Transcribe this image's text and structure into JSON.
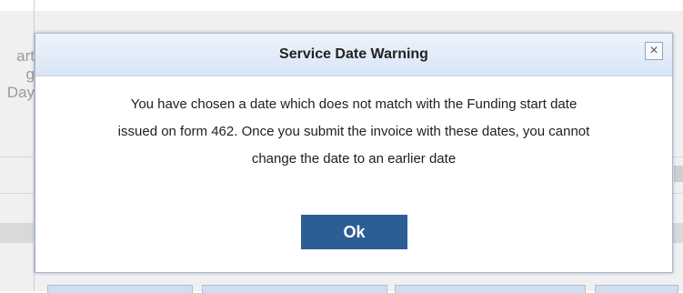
{
  "background": {
    "column_header_lines": [
      "art",
      "g",
      "Day"
    ]
  },
  "dialog": {
    "title": "Service Date Warning",
    "close_symbol": "×",
    "message_lines": [
      "You have chosen a date which does not match with the Funding start date",
      "issued on form 462. Once you submit the invoice with these dates, you cannot",
      "change the date to an earlier date"
    ],
    "ok_label": "Ok"
  },
  "colors": {
    "header_gradient_top": "#eef3fb",
    "header_gradient_bottom": "#d9e5f5",
    "button_primary": "#2d5d96",
    "dialog_border": "#9fb8d9"
  },
  "icons": {
    "close": "close-icon"
  }
}
